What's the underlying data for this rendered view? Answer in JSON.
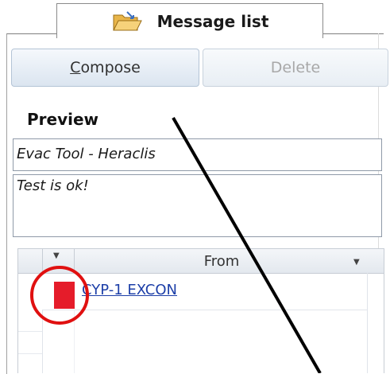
{
  "header": {
    "title": "Message list",
    "icon": "folder-open-icon"
  },
  "toolbar": {
    "compose_mnemonic": "C",
    "compose_rest": "ompose",
    "delete_label": "Delete"
  },
  "preview": {
    "label": "Preview",
    "subject": "Evac Tool - Heraclis",
    "body": "Test is ok!"
  },
  "messages": {
    "columns": [
      "From"
    ],
    "rows": [
      {
        "flag_color": "#e51c2a",
        "from": "CYP-1  EXCON"
      }
    ]
  },
  "colors": {
    "annotation_circle": "#e01010",
    "annotation_line": "#000000",
    "link": "#1d3fa8"
  }
}
